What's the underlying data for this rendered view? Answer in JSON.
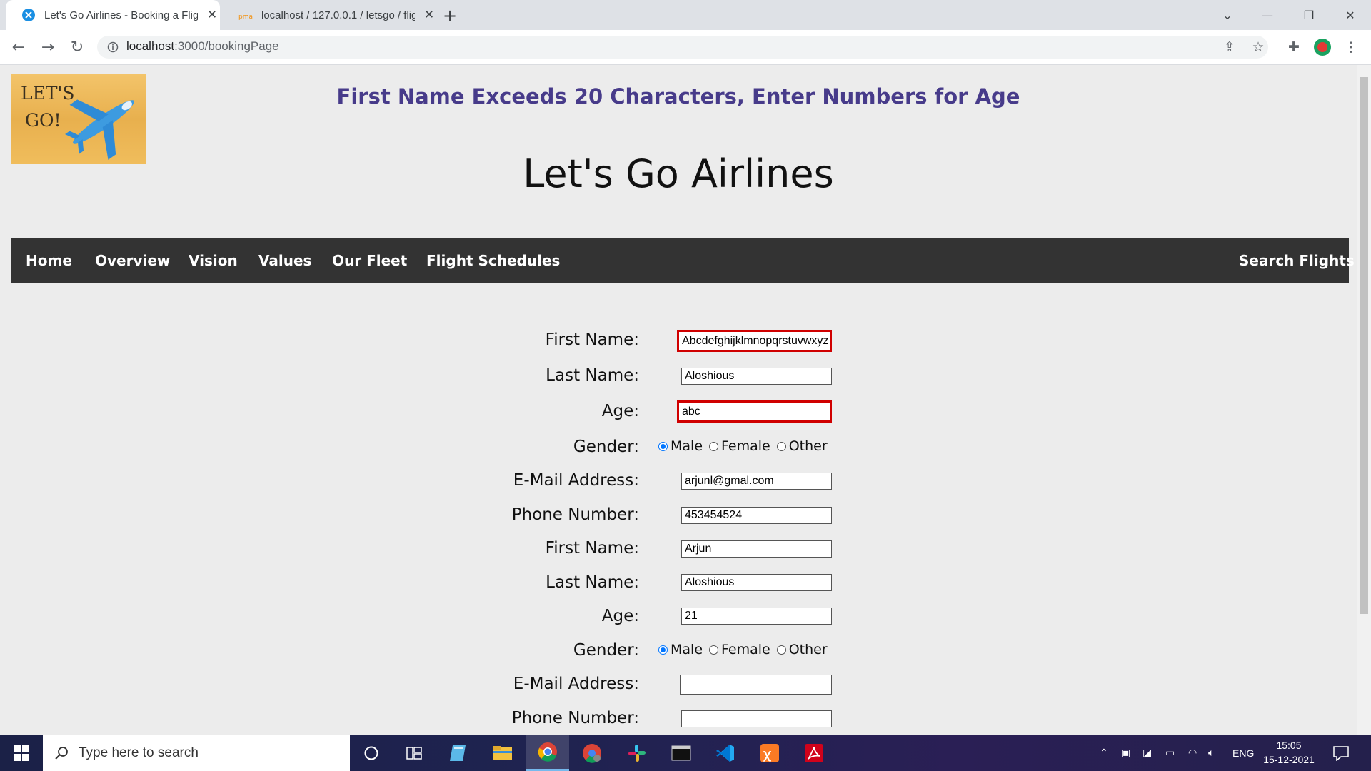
{
  "browser": {
    "tabs": [
      {
        "title": "Let's Go Airlines - Booking a Fligh",
        "active": true
      },
      {
        "title": "localhost / 127.0.0.1 / letsgo / flig",
        "active": false
      }
    ],
    "url_host": "localhost",
    "url_path": ":3000/bookingPage"
  },
  "page": {
    "logo_line1": "LET'S",
    "logo_line2": "GO!",
    "error_message": "First Name Exceeds 20 Characters, Enter Numbers for Age",
    "site_title": "Let's Go Airlines",
    "nav": {
      "items": [
        "Home",
        "Overview",
        "Vision",
        "Values",
        "Our Fleet",
        "Flight Schedules"
      ],
      "right_item": "Search Flights"
    },
    "passengers": [
      {
        "first_name_label": "First Name:",
        "first_name": "Abcdefghijklmnopqrstuvwxyz",
        "last_name_label": "Last Name:",
        "last_name": "Aloshious",
        "age_label": "Age:",
        "age": "abc",
        "gender_label": "Gender:",
        "gender_options": [
          "Male",
          "Female",
          "Other"
        ],
        "gender_selected": "Male",
        "email_label": "E-Mail Address:",
        "email": "arjunl@gmal.com",
        "phone_label": "Phone Number:",
        "phone": "453454524"
      },
      {
        "first_name_label": "First Name:",
        "first_name": "Arjun",
        "last_name_label": "Last Name:",
        "last_name": "Aloshious",
        "age_label": "Age:",
        "age": "21",
        "gender_label": "Gender:",
        "gender_options": [
          "Male",
          "Female",
          "Other"
        ],
        "gender_selected": "Male",
        "email_label": "E-Mail Address:",
        "email": "",
        "phone_label": "Phone Number:",
        "phone": ""
      }
    ]
  },
  "taskbar": {
    "search_placeholder": "Type here to search",
    "language": "ENG",
    "time": "15:05",
    "date": "15-12-2021"
  },
  "colors": {
    "error_text": "#473b8a",
    "error_border": "#d00000",
    "navbar_bg": "#333333"
  }
}
